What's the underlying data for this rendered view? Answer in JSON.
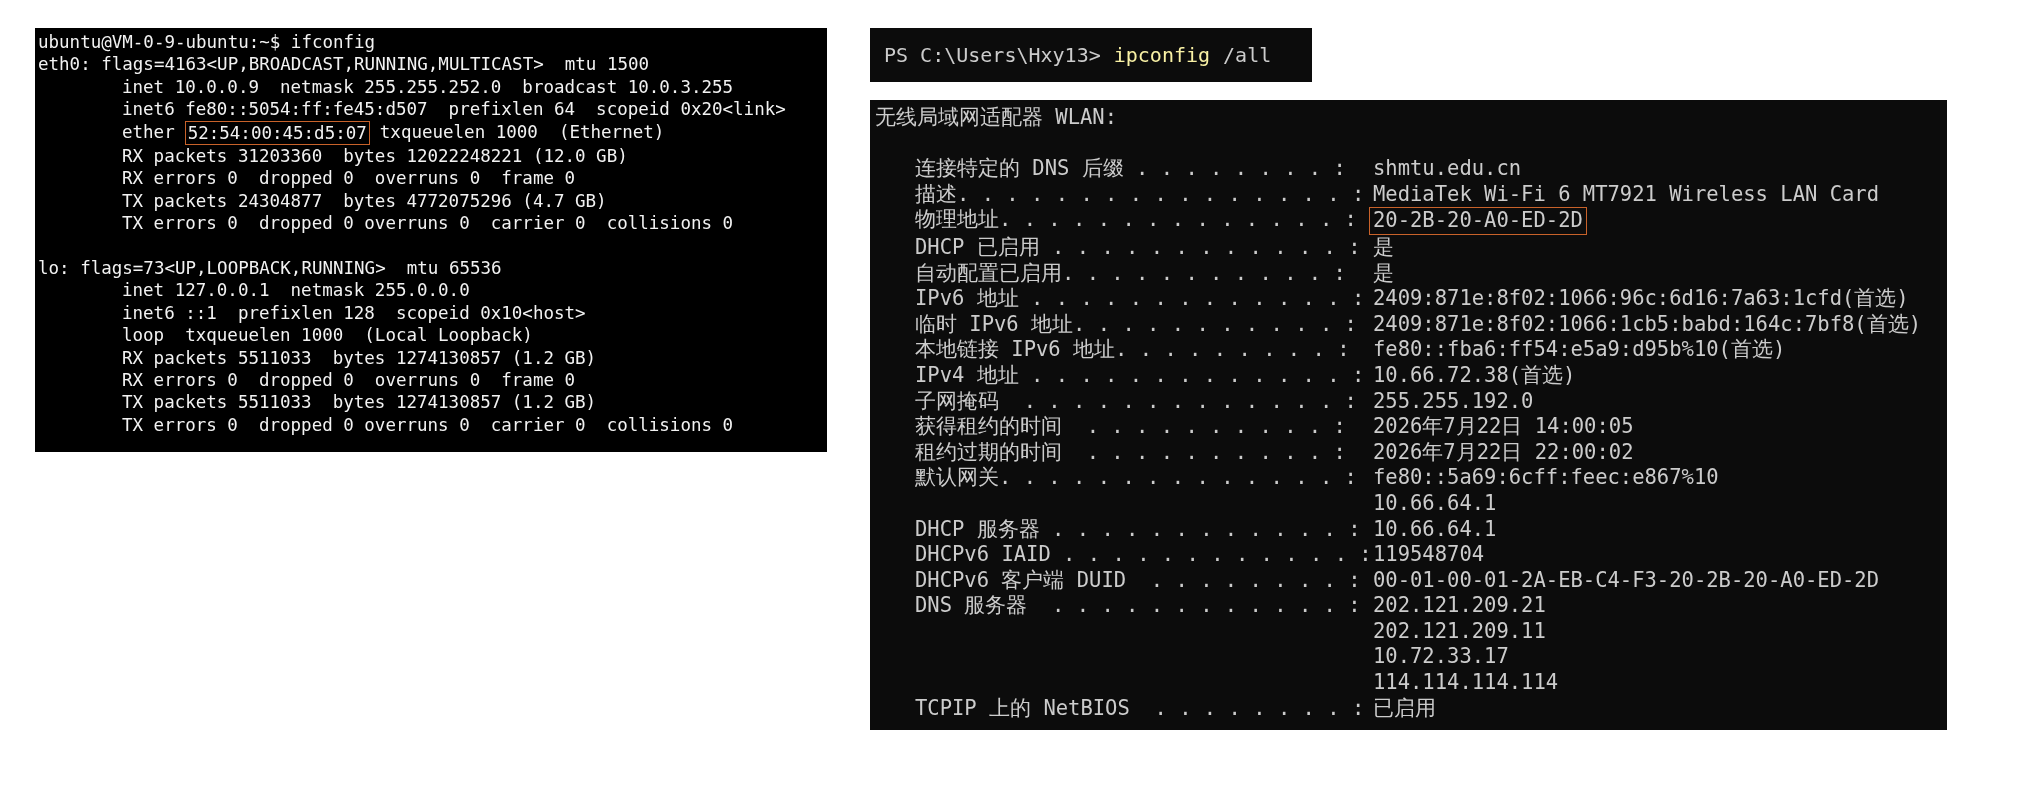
{
  "linux_terminal": {
    "blocks": [
      {
        "lines": [
          {
            "indent": false,
            "parts": [
              {
                "text": "ubuntu@VM-0-9-ubuntu:~$ ifconfig",
                "boxed": false
              }
            ]
          },
          {
            "indent": false,
            "parts": [
              {
                "text": "eth0: flags=4163<UP,BROADCAST,RUNNING,MULTICAST>  mtu 1500",
                "boxed": false
              }
            ]
          },
          {
            "indent": true,
            "parts": [
              {
                "text": "inet 10.0.0.9  netmask 255.255.252.0  broadcast 10.0.3.255",
                "boxed": false
              }
            ]
          },
          {
            "indent": true,
            "parts": [
              {
                "text": "inet6 fe80::5054:ff:fe45:d507  prefixlen 64  scopeid 0x20<link>",
                "boxed": false
              }
            ]
          },
          {
            "indent": true,
            "parts": [
              {
                "text": "ether",
                "boxed": false
              },
              {
                "text": "52:54:00:45:d5:07",
                "boxed": true
              },
              {
                "text": "txqueuelen 1000  (Ethernet)",
                "boxed": false
              }
            ]
          },
          {
            "indent": true,
            "parts": [
              {
                "text": "RX packets 31203360  bytes 12022248221 (12.0 GB)",
                "boxed": false
              }
            ]
          },
          {
            "indent": true,
            "parts": [
              {
                "text": "RX errors 0  dropped 0  overruns 0  frame 0",
                "boxed": false
              }
            ]
          },
          {
            "indent": true,
            "parts": [
              {
                "text": "TX packets 24304877  bytes 4772075296 (4.7 GB)",
                "boxed": false
              }
            ]
          },
          {
            "indent": true,
            "parts": [
              {
                "text": "TX errors 0  dropped 0 overruns 0  carrier 0  collisions 0",
                "boxed": false
              }
            ]
          }
        ]
      },
      {
        "lines": [
          {
            "indent": false,
            "parts": [
              {
                "text": "lo: flags=73<UP,LOOPBACK,RUNNING>  mtu 65536",
                "boxed": false
              }
            ]
          },
          {
            "indent": true,
            "parts": [
              {
                "text": "inet 127.0.0.1  netmask 255.0.0.0",
                "boxed": false
              }
            ]
          },
          {
            "indent": true,
            "parts": [
              {
                "text": "inet6 ::1  prefixlen 128  scopeid 0x10<host>",
                "boxed": false
              }
            ]
          },
          {
            "indent": true,
            "parts": [
              {
                "text": "loop  txqueuelen 1000  (Local Loopback)",
                "boxed": false
              }
            ]
          },
          {
            "indent": true,
            "parts": [
              {
                "text": "RX packets 5511033  bytes 1274130857 (1.2 GB)",
                "boxed": false
              }
            ]
          },
          {
            "indent": true,
            "parts": [
              {
                "text": "RX errors 0  dropped 0  overruns 0  frame 0",
                "boxed": false
              }
            ]
          },
          {
            "indent": true,
            "parts": [
              {
                "text": "TX packets 5511033  bytes 1274130857 (1.2 GB)",
                "boxed": false
              }
            ]
          },
          {
            "indent": true,
            "parts": [
              {
                "text": "TX errors 0  dropped 0 overruns 0  carrier 0  collisions 0",
                "boxed": false
              }
            ]
          }
        ]
      }
    ]
  },
  "powershell_prompt": {
    "parts": [
      {
        "kind": "prompt",
        "text": "PS C:\\Users\\Hxy13>"
      },
      {
        "kind": "command",
        "text": "ipconfig"
      },
      {
        "kind": "argument",
        "text": "/all"
      }
    ]
  },
  "ipconfig_output": {
    "heading": "无线局域网适配器 WLAN:",
    "rows": [
      {
        "label": "连接特定的 DNS 后缀 . . . . . . . . :",
        "value": "shmtu.edu.cn",
        "boxed": false
      },
      {
        "label": "描述. . . . . . . . . . . . . . . . :",
        "value": "MediaTek Wi-Fi 6 MT7921 Wireless LAN Card",
        "boxed": false
      },
      {
        "label": "物理地址. . . . . . . . . . . . . . :",
        "value": "20-2B-20-A0-ED-2D",
        "boxed": true
      },
      {
        "label": "DHCP 已启用 . . . . . . . . . . . . :",
        "value": "是",
        "boxed": false
      },
      {
        "label": "自动配置已启用. . . . . . . . . . . :",
        "value": "是",
        "boxed": false
      },
      {
        "label": "IPv6 地址 . . . . . . . . . . . . . :",
        "value": "2409:871e:8f02:1066:96c:6d16:7a63:1cfd(首选)",
        "boxed": false
      },
      {
        "label": "临时 IPv6 地址. . . . . . . . . . . :",
        "value": "2409:871e:8f02:1066:1cb5:babd:164c:7bf8(首选)",
        "boxed": false
      },
      {
        "label": "本地链接 IPv6 地址. . . . . . . . . :",
        "value": "fe80::fba6:ff54:e5a9:d95b%10(首选)",
        "boxed": false
      },
      {
        "label": "IPv4 地址 . . . . . . . . . . . . . :",
        "value": "10.66.72.38(首选)",
        "boxed": false
      },
      {
        "label": "子网掩码  . . . . . . . . . . . . . :",
        "value": "255.255.192.0",
        "boxed": false
      },
      {
        "label": "获得租约的时间  . . . . . . . . . . :",
        "value": "2026年7月22日 14:00:05",
        "boxed": false
      },
      {
        "label": "租约过期的时间  . . . . . . . . . . :",
        "value": "2026年7月22日 22:00:02",
        "boxed": false
      },
      {
        "label": "默认网关. . . . . . . . . . . . . . :",
        "value": "fe80::5a69:6cff:feec:e867%10",
        "boxed": false
      },
      {
        "value": "10.66.64.1",
        "boxed": false
      },
      {
        "label": "DHCP 服务器 . . . . . . . . . . . . :",
        "value": "10.66.64.1",
        "boxed": false
      },
      {
        "label": "DHCPv6 IAID . . . . . . . . . . . . :",
        "value": "119548704",
        "boxed": false
      },
      {
        "label": "DHCPv6 客户端 DUID  . . . . . . . . :",
        "value": "00-01-00-01-2A-EB-C4-F3-20-2B-20-A0-ED-2D",
        "boxed": false
      },
      {
        "label": "DNS 服务器  . . . . . . . . . . . . :",
        "value": "202.121.209.21",
        "boxed": false
      },
      {
        "value": "202.121.209.11",
        "boxed": false
      },
      {
        "value": "10.72.33.17",
        "boxed": false
      },
      {
        "value": "114.114.114.114",
        "boxed": false
      },
      {
        "label": "TCPIP 上的 NetBIOS  . . . . . . . . :",
        "value": "已启用",
        "boxed": false
      }
    ]
  }
}
